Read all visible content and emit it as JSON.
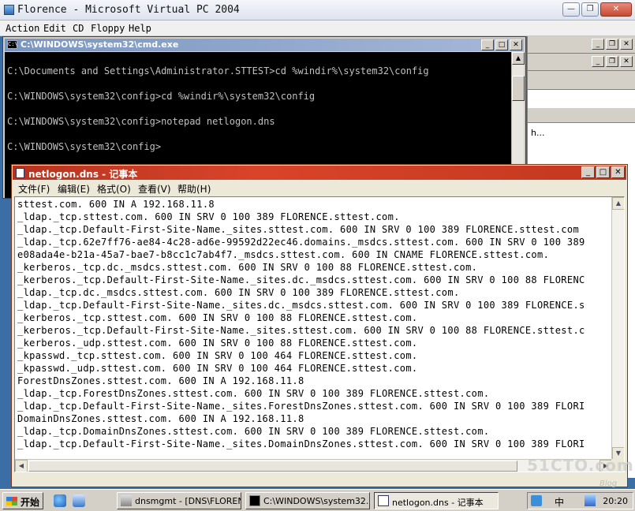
{
  "host": {
    "title": "Florence - Microsoft Virtual PC 2004",
    "menu": [
      "Action",
      "Edit",
      "CD",
      "Floppy",
      "Help"
    ]
  },
  "mmc": {
    "visible_text": "h..."
  },
  "cmd": {
    "title": "C:\\WINDOWS\\system32\\cmd.exe",
    "lines": [
      "C:\\Documents and Settings\\Administrator.STTEST>cd %windir%\\system32\\config",
      "C:\\WINDOWS\\system32\\config>cd %windir%\\system32\\config",
      "C:\\WINDOWS\\system32\\config>notepad netlogon.dns",
      "C:\\WINDOWS\\system32\\config>"
    ]
  },
  "notepad": {
    "title": "netlogon.dns - 记事本",
    "menu": [
      "文件(F)",
      "编辑(E)",
      "格式(O)",
      "查看(V)",
      "帮助(H)"
    ],
    "lines": [
      "sttest.com. 600 IN A 192.168.11.8",
      "_ldap._tcp.sttest.com. 600 IN SRV 0 100 389 FLORENCE.sttest.com.",
      "_ldap._tcp.Default-First-Site-Name._sites.sttest.com. 600 IN SRV 0 100 389 FLORENCE.sttest.com",
      "_ldap._tcp.62e7ff76-ae84-4c28-ad6e-99592d22ec46.domains._msdcs.sttest.com. 600 IN SRV 0 100 389",
      "e08ada4e-b21a-45a7-bae7-b8cc1c7ab4f7._msdcs.sttest.com. 600 IN CNAME FLORENCE.sttest.com.",
      "_kerberos._tcp.dc._msdcs.sttest.com. 600 IN SRV 0 100 88 FLORENCE.sttest.com.",
      "_kerberos._tcp.Default-First-Site-Name._sites.dc._msdcs.sttest.com. 600 IN SRV 0 100 88 FLORENC",
      "_ldap._tcp.dc._msdcs.sttest.com. 600 IN SRV 0 100 389 FLORENCE.sttest.com.",
      "_ldap._tcp.Default-First-Site-Name._sites.dc._msdcs.sttest.com. 600 IN SRV 0 100 389 FLORENCE.s",
      "_kerberos._tcp.sttest.com. 600 IN SRV 0 100 88 FLORENCE.sttest.com.",
      "_kerberos._tcp.Default-First-Site-Name._sites.sttest.com. 600 IN SRV 0 100 88 FLORENCE.sttest.c",
      "_kerberos._udp.sttest.com. 600 IN SRV 0 100 88 FLORENCE.sttest.com.",
      "_kpasswd._tcp.sttest.com. 600 IN SRV 0 100 464 FLORENCE.sttest.com.",
      "_kpasswd._udp.sttest.com. 600 IN SRV 0 100 464 FLORENCE.sttest.com.",
      "ForestDnsZones.sttest.com. 600 IN A 192.168.11.8",
      "_ldap._tcp.ForestDnsZones.sttest.com. 600 IN SRV 0 100 389 FLORENCE.sttest.com.",
      "_ldap._tcp.Default-First-Site-Name._sites.ForestDnsZones.sttest.com. 600 IN SRV 0 100 389 FLORI",
      "DomainDnsZones.sttest.com. 600 IN A 192.168.11.8",
      "_ldap._tcp.DomainDnsZones.sttest.com. 600 IN SRV 0 100 389 FLORENCE.sttest.com.",
      "_ldap._tcp.Default-First-Site-Name._sites.DomainDnsZones.sttest.com. 600 IN SRV 0 100 389 FLORI"
    ]
  },
  "taskbar": {
    "start_label": "开始",
    "tasks": [
      "dnsmgmt - [DNS\\FLOREN...",
      "C:\\WINDOWS\\system32...",
      "netlogon.dns - 记事本"
    ],
    "tray_text": "中",
    "clock": "20:20"
  },
  "watermark": {
    "main": "51CTO.com",
    "sub": "Blog"
  },
  "colors": {
    "notepad_title": "#c2381f",
    "cmd_title": "#7a96c0",
    "desktop": "#3a6ea5"
  }
}
